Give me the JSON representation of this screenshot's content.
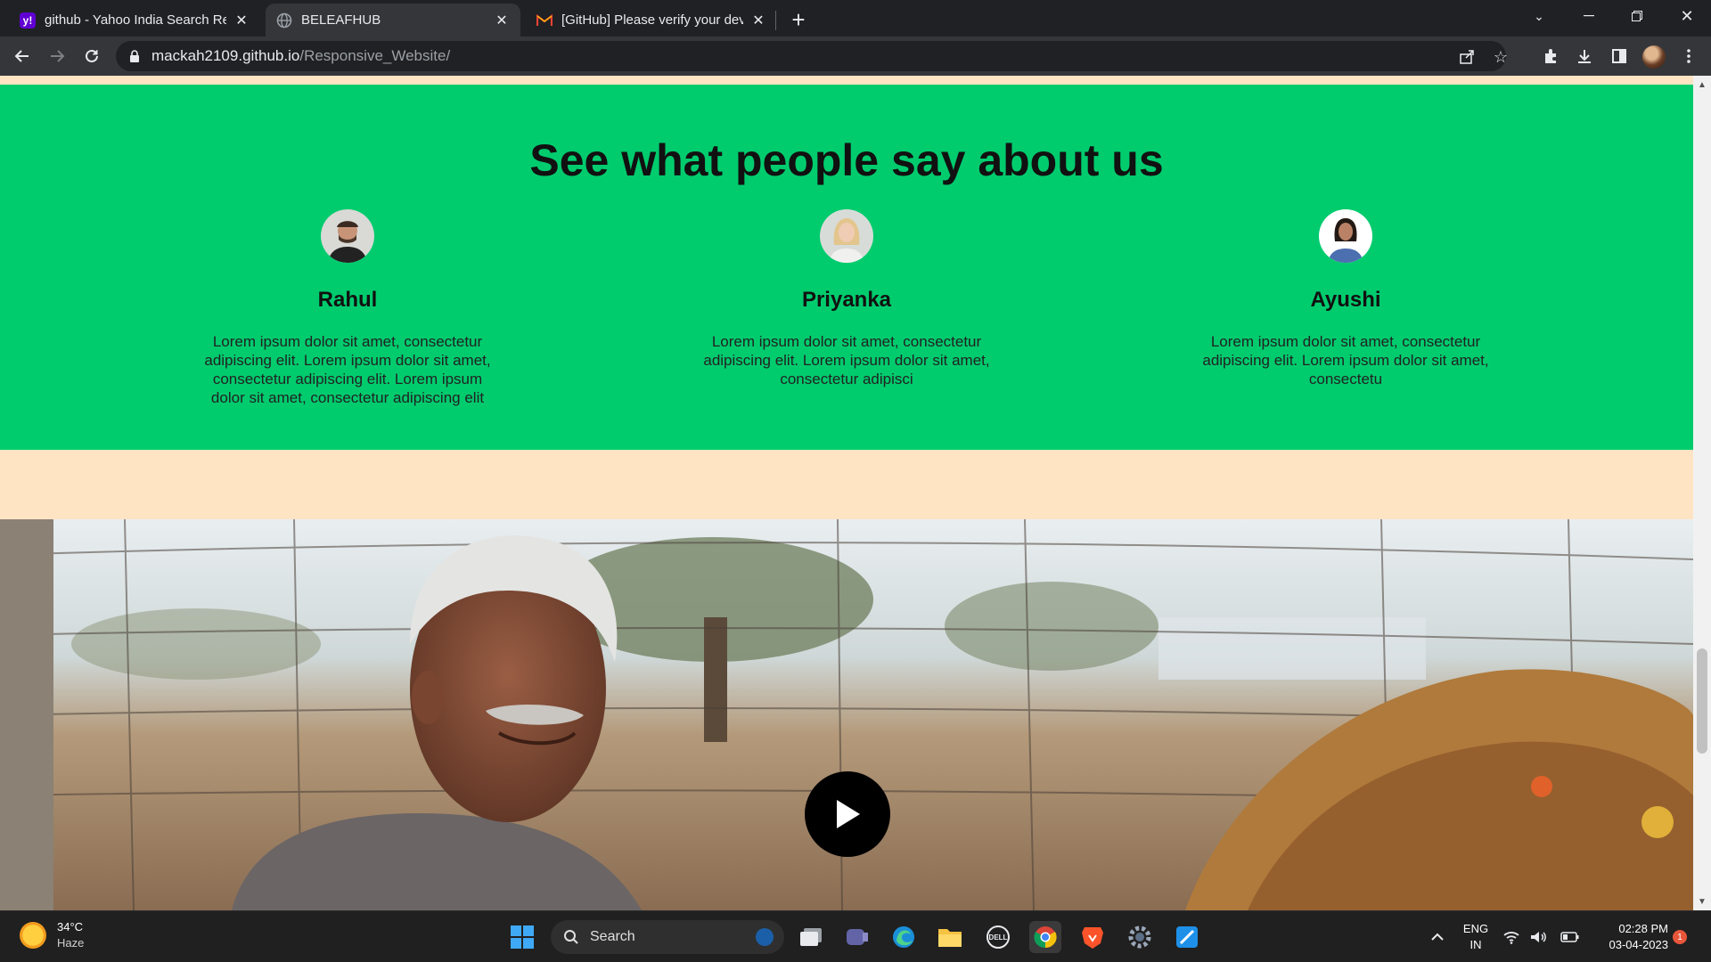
{
  "browser": {
    "tabs": [
      {
        "title": "github - Yahoo India Search Resu",
        "favicon": "yahoo-icon",
        "favicon_color": "#6001d2",
        "active": false
      },
      {
        "title": "BELEAFHUB",
        "favicon": "globe-icon",
        "favicon_color": "#9aa0a6",
        "active": true
      },
      {
        "title": "[GitHub] Please verify your devic",
        "favicon": "gmail-icon",
        "favicon_color": "#ea4335",
        "active": false
      }
    ],
    "new_tab_label": "+",
    "url_host": "mackah2109.github.io",
    "url_path": "/Responsive_Website/"
  },
  "page": {
    "testimonials": {
      "heading": "See what people say about us",
      "people": [
        {
          "name": "Rahul",
          "text": "Lorem ipsum dolor sit amet, consectetur adipiscing elit. Lorem ipsum dolor sit amet, consectetur adipiscing elit. Lorem ipsum dolor sit amet, consectetur adipiscing elit"
        },
        {
          "name": "Priyanka",
          "text": "Lorem ipsum dolor sit amet, consectetur adipiscing elit. Lorem ipsum dolor sit amet, consectetur adipisci"
        },
        {
          "name": "Ayushi",
          "text": "Lorem ipsum dolor sit amet, consectetur adipiscing elit. Lorem ipsum dolor sit amet, consectetu"
        }
      ]
    },
    "colors": {
      "section_bg": "#00cc6e",
      "page_bg": "#ffe4c4"
    },
    "video": {
      "play_icon": "play-icon"
    }
  },
  "taskbar": {
    "weather_temp": "34°C",
    "weather_desc": "Haze",
    "search_placeholder": "Search",
    "lang_line1": "ENG",
    "lang_line2": "IN",
    "time": "02:28 PM",
    "date": "03-04-2023",
    "notification_count": "1"
  }
}
